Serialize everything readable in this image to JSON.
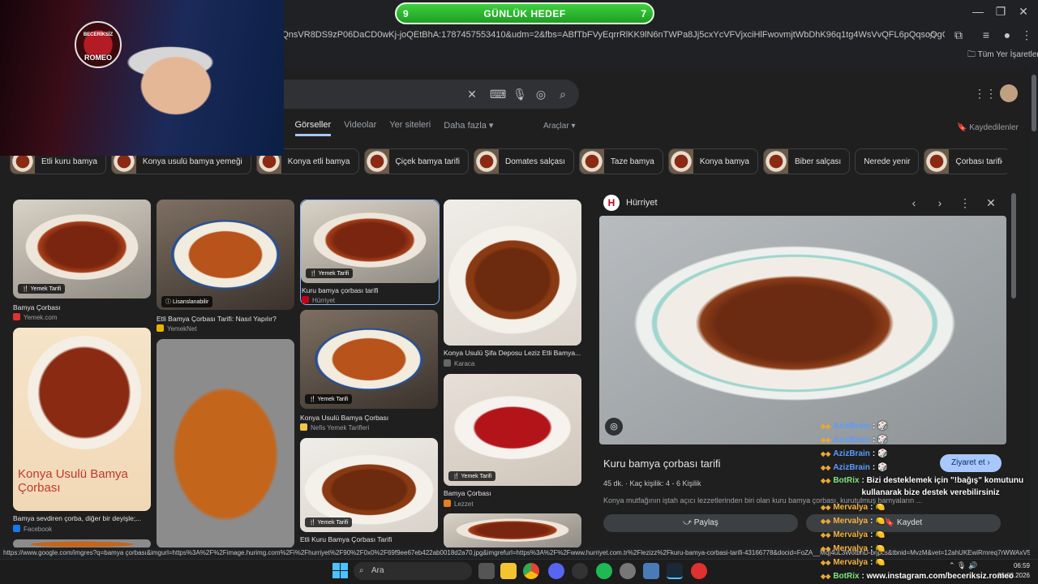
{
  "browser": {
    "address": "oeQnsVR8DS9zP06DaCD0wKj-joQEtBhA:1787457553410&udm=2&fbs=ABfTbFVyEqrrRlKK9lN6nTWPa8Jj5cxYcVFVjxciHlFwovmjtWbDhK96q1tg4WsVvQFL6pQqsoOgONWelv7bjYwSg-x9b9A...",
    "bookmarks_folder": "Tüm Yer İşaretleri",
    "window_controls": [
      "—",
      "❐",
      "✕"
    ]
  },
  "goal": {
    "left": "9",
    "title": "GÜNLÜK HEDEF",
    "right": "7"
  },
  "search": {
    "tabs": [
      "s",
      "Görseller",
      "Videolar",
      "Yer siteleri",
      "Daha fazla ▾"
    ],
    "tools": "Araçlar ▾",
    "saved": "Kaydedilenler"
  },
  "chips": [
    {
      "label": "Etli kuru bamya",
      "thumb": true
    },
    {
      "label": "Konya usulü bamya yemeği",
      "thumb": true
    },
    {
      "label": "Konya etli bamya",
      "thumb": true
    },
    {
      "label": "Çiçek bamya tarifi",
      "thumb": true
    },
    {
      "label": "Domates salçası",
      "thumb": true
    },
    {
      "label": "Taze bamya",
      "thumb": true
    },
    {
      "label": "Konya bamya",
      "thumb": true
    },
    {
      "label": "Biber salçası",
      "thumb": true
    },
    {
      "label": "Nerede yenir",
      "thumb": false
    },
    {
      "label": "Çorbası tarifi",
      "thumb": true
    }
  ],
  "results": [
    {
      "title": "Bamya Çorbası",
      "source": "Yemek.com",
      "badge": "🍴 Yemek Tarifi"
    },
    {
      "title": "Etli Bamya Çorbası Tarifi: Nasıl Yapılır?",
      "source": "YemekNet",
      "badge": "ⓘ Lisanslanabilir"
    },
    {
      "title": "Kuru bamya çorbası tarifi",
      "source": "Hürriyet",
      "badge": "🍴 Yemek Tarifi"
    },
    {
      "title": "Konya Usulü Şifa Deposu Leziz Etli Bamya...",
      "source": "Karaca",
      "badge": ""
    },
    {
      "title": "Bamya sevdiren çorba, diğer bir deyişle;...",
      "source": "Facebook",
      "badge": "",
      "poster_text": "Konya Usulü Bamya Çorbası"
    },
    {
      "title": "Konya Usulü Bamya Çorbası",
      "source": "Nefis Yemek Tarifleri",
      "badge": "🍴 Yemek Tarifi"
    },
    {
      "title": "Bamya Çorbası",
      "source": "Lezzet",
      "badge": "🍴 Yemek Tarifi"
    },
    {
      "title": "Etli Kuru Bamya Çorbası Tarifi",
      "source": "",
      "badge": "🍴 Yemek Tarifi"
    }
  ],
  "detail": {
    "source": "Hürriyet",
    "logo": "H",
    "title": "Kuru bamya çorbası tarifi",
    "visit": "Ziyaret et ›",
    "meta": "45 dk.   ·   Kaç kişilik: 4 - 6 Kişilik",
    "description": "Konya mutfağının iştah açıcı lezzetlerinden biri olan kuru bamya çorbası, kurutulmuş bamyaların ...",
    "share": "⤻ Paylaş",
    "save": "🔖 Kaydet"
  },
  "status_url": "https://www.google.com/imgres?q=bamya çorbası&imgurl=https%3A%2F%2Fimage.hurimg.com%2Fi%2Fhurriyet%2F90%2F0x0%2F69f9ee67eb422ab0018d2a70.jpg&imgrefurl=https%3A%2F%2Fwww.hurriyet.com.tr%2Flezizz%2Fkuru-bamya-corbasi-tarifi-43166778&docid=FoZA__Mq|4uL3WotbnD-brjpcs&tbnid=MvzM&vet=12ahUKEwiRmreq7rWWAxV5...",
  "taskbar": {
    "search": "Ara",
    "time": "06:59",
    "date": "23.08.2026"
  },
  "webcam": {
    "logo_top": "BECERİKSİZ",
    "logo_text": "ROMEO"
  },
  "chat": [
    {
      "user": "AzizBrain",
      "msg": ": 🎲",
      "type": "user"
    },
    {
      "user": "AzizBrain",
      "msg": ": 🎲",
      "type": "user"
    },
    {
      "user": "AzizBrain",
      "msg": ": 🎲",
      "type": "user"
    },
    {
      "user": "AzizBrain",
      "msg": ": 🎲",
      "type": "user"
    },
    {
      "user": "BotRix",
      "msg": ": Bizi desteklemek için \"!bağış\" komutunu kullanarak bize destek verebilirsiniz",
      "type": "bot"
    },
    {
      "user": "Mervalya",
      "msg": ": 🍋",
      "type": "mv"
    },
    {
      "user": "Mervalya",
      "msg": ": 🍋",
      "type": "mv"
    },
    {
      "user": "Mervalya",
      "msg": ": 🍋",
      "type": "mv"
    },
    {
      "user": "Mervalya",
      "msg": ": 🍋",
      "type": "mv"
    },
    {
      "user": "Mervalya",
      "msg": ": 🍋",
      "type": "mv"
    },
    {
      "user": "BotRix",
      "msg": ": www.instagram.com/beceriksiz.romeo",
      "type": "bot"
    }
  ]
}
